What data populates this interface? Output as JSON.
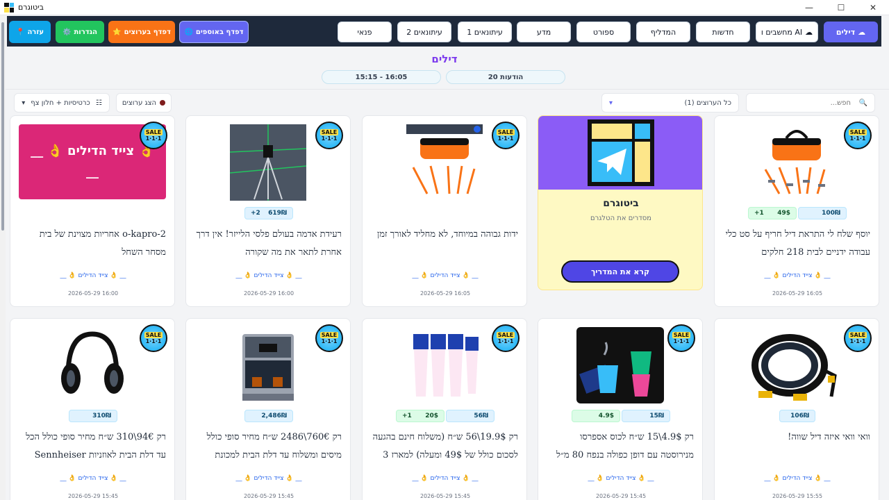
{
  "window": {
    "title": "ביטוגרם"
  },
  "nav": {
    "tabs": [
      {
        "label": "דילים",
        "active": true
      },
      {
        "label": "מחשבים ו AI"
      },
      {
        "label": "חדשות"
      },
      {
        "label": "המדליף"
      },
      {
        "label": "ספורט"
      },
      {
        "label": "מדע"
      },
      {
        "label": "עיתונאים 1"
      },
      {
        "label": "עיתונאים 2"
      },
      {
        "label": "פנאי"
      }
    ],
    "buttons": [
      {
        "label": "דפדף באוספים",
        "icon": "globe-icon",
        "color": "#6366f1"
      },
      {
        "label": "דפדף בערוצים",
        "icon": "star-icon",
        "color": "#f97316"
      },
      {
        "label": "הגדרות",
        "icon": "gear-icon",
        "color": "#22c55e"
      },
      {
        "label": "עזרה",
        "icon": "pin-icon",
        "color": "#0ea5e9"
      }
    ]
  },
  "page": {
    "heading": "דילים",
    "stats": {
      "messages": "20 הודעות",
      "time_range": "15:15 - 16:05"
    }
  },
  "toolbar": {
    "search_placeholder": "חפש...",
    "channels_select": "כל הערוצים (1)",
    "show_channels": "הצג ערוצים",
    "view_mode": "כרטיסיות + חלון צף"
  },
  "cards": [
    {
      "prices": [
        {
          "value": "100₪"
        },
        {
          "value": "49$",
          "extra": "+1"
        }
      ],
      "text": "יוסף שלח לי התראת דיל חריף על סט כלי עבודה ידניים לבית 218 חלקים",
      "source": "__ 👌 צייד הדילים 👌 __",
      "date": "2026-05-29 16:05"
    },
    {
      "promo": true,
      "title": "ביטוגרם",
      "subtitle": "מסדרים את הטלגרם",
      "button": "קרא את המדריך"
    },
    {
      "prices": [],
      "text": "ידות גבוהה במיוחד, לא מחליד לאורך זמן",
      "source": "__ 👌 צייד הדילים 👌 __",
      "date": "2026-05-29 16:05"
    },
    {
      "prices": [
        {
          "value": "619₪",
          "extra": "+2"
        }
      ],
      "text": "רעידת אדמה בעולם פלסי הלייזר! אין דרך אחרת לתאר את מה שקורה",
      "source": "__ 👌 צייד הדילים 👌 __",
      "date": "2026-05-29 16:00"
    },
    {
      "prices": [],
      "banner": "👌 צייד הדילים 👌 __ __",
      "text": "o-kapro-2 אחריות מצוינת של בית מסחר השחל",
      "source": "__ 👌 צייד הדילים 👌 __",
      "date": "2026-05-29 16:00"
    },
    {
      "prices": [
        {
          "value": "106₪"
        }
      ],
      "text": "וואי וואי איזה דיל שווה!",
      "source": "__ 👌 צייד הדילים 👌 __",
      "date": "2026-05-29 15:55"
    },
    {
      "prices": [
        {
          "value": "15₪"
        },
        {
          "value": "4.9$"
        }
      ],
      "text": "רק 4.9$\\15 ש״ח לכוס אספרסו מנירוסטה עם דופן כפולה בנפח 80 מ״ל",
      "source": "__ 👌 צייד הדילים 👌 __",
      "date": "2026-05-29 15:45"
    },
    {
      "prices": [
        {
          "value": "56₪"
        },
        {
          "value": "20$",
          "extra": "+1"
        }
      ],
      "text": "רק 19.9$\\56 ש״ח (משלוח חינם בהגעה לסכום כולל של 49$ ומעלה) למארז 3",
      "source": "__ 👌 צייד הדילים 👌 __",
      "date": "2026-05-29 15:45"
    },
    {
      "prices": [
        {
          "value": "2,486₪"
        }
      ],
      "text": "רק 760€\\2486 ש״ח מחיר סופי כולל מיסים ומשלוח עד דלת הבית למכונת",
      "source": "__ 👌 צייד הדילים 👌 __",
      "date": "2026-05-29 15:45"
    },
    {
      "prices": [
        {
          "value": "310₪"
        }
      ],
      "text": "רק 94€\\310 ש״ח מחיר סופי כולל הכל עד דלת הבית לאוזניות Sennheiser",
      "source": "__ 👌 צייד הדילים 👌 __",
      "date": "2026-05-29 15:45"
    }
  ],
  "badge": {
    "line1": "SALE",
    "line2": "1·1·1"
  },
  "colors": {
    "accent": "#6366f1",
    "heading": "#7c3aed",
    "promo_bg": "#fef9c3",
    "banner_bg": "#db2777"
  }
}
